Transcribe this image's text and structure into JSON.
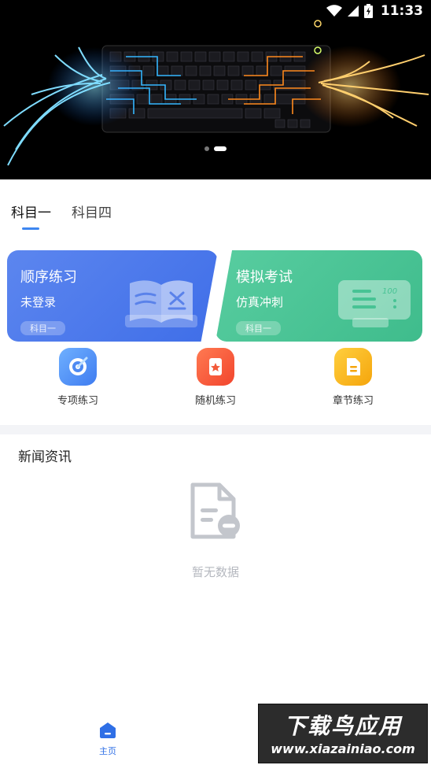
{
  "status_bar": {
    "time": "11:33"
  },
  "banner": {
    "slide_count": 2,
    "active_slide": 2
  },
  "tabs": [
    {
      "label": "科目一",
      "active": true
    },
    {
      "label": "科目四",
      "active": false
    }
  ],
  "cards": {
    "sequential": {
      "title": "顺序练习",
      "subtitle": "未登录",
      "tag": "科目一"
    },
    "mock_exam": {
      "title": "模拟考试",
      "subtitle": "仿真冲刺",
      "tag": "科目一",
      "illus_text": "100"
    }
  },
  "quick_actions": [
    {
      "label": "专项练习"
    },
    {
      "label": "随机练习"
    },
    {
      "label": "章节练习"
    }
  ],
  "news": {
    "title": "新闻资讯",
    "empty_text": "暂无数据"
  },
  "bottom_nav": {
    "home_label": "主页"
  },
  "watermark": {
    "line1": "下载鸟应用",
    "line2": "www.xiazainiao.com"
  },
  "colors": {
    "accent": "#3d86f0",
    "blue_card": "#4a76ea",
    "green_card": "#47c394"
  }
}
